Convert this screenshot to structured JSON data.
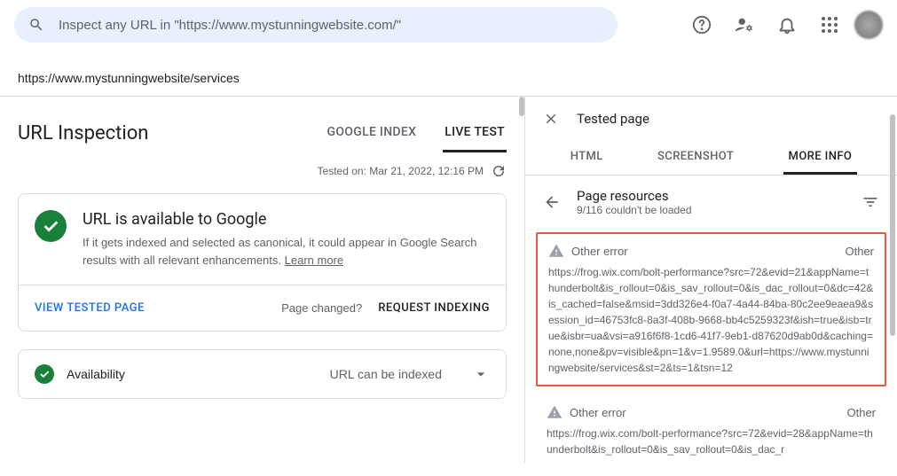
{
  "search": {
    "placeholder": "Inspect any URL in \"https://www.mystunningwebsite.com/\""
  },
  "inspected_url": "https://www.mystunningwebsite/services",
  "section_title": "URL Inspection",
  "left_tabs": {
    "google_index": "GOOGLE INDEX",
    "live_test": "LIVE TEST"
  },
  "tested_on": "Tested on: Mar 21, 2022, 12:16 PM",
  "availability_card": {
    "title": "URL is available to Google",
    "body_prefix": "If it gets indexed and selected as canonical, it could appear in Google Search results with all relevant enhancements. ",
    "learn_more": "Learn more",
    "view_tested": "VIEW TESTED PAGE",
    "page_changed": "Page changed?",
    "request_indexing": "REQUEST INDEXING"
  },
  "availability_row": {
    "label": "Availability",
    "status": "URL can be indexed"
  },
  "right_header": "Tested page",
  "right_tabs": {
    "html": "HTML",
    "screenshot": "SCREENSHOT",
    "more_info": "MORE INFO"
  },
  "resources": {
    "title": "Page resources",
    "subtitle": "9/116 couldn't be loaded"
  },
  "errors": [
    {
      "label": "Other error",
      "tag": "Other",
      "url": "https://frog.wix.com/bolt-performance?src=72&evid=21&appName=thunderbolt&is_rollout=0&is_sav_rollout=0&is_dac_rollout=0&dc=42&is_cached=false&msid=3dd326e4-f0a7-4a44-84ba-80c2ee9eaea9&session_id=46753fc8-8a3f-408b-9668-bb4c5259323f&ish=true&isb=true&isbr=ua&vsi=a916f6f8-1cd6-41f7-9eb1-d87620d9ab0d&caching=none,none&pv=visible&pn=1&v=1.9589.0&url=https://www.mystunningwebsite/services&st=2&ts=1&tsn=12"
    },
    {
      "label": "Other error",
      "tag": "Other",
      "url": "https://frog.wix.com/bolt-performance?src=72&evid=28&appName=thunderbolt&is_rollout=0&is_sav_rollout=0&is_dac_r"
    }
  ]
}
